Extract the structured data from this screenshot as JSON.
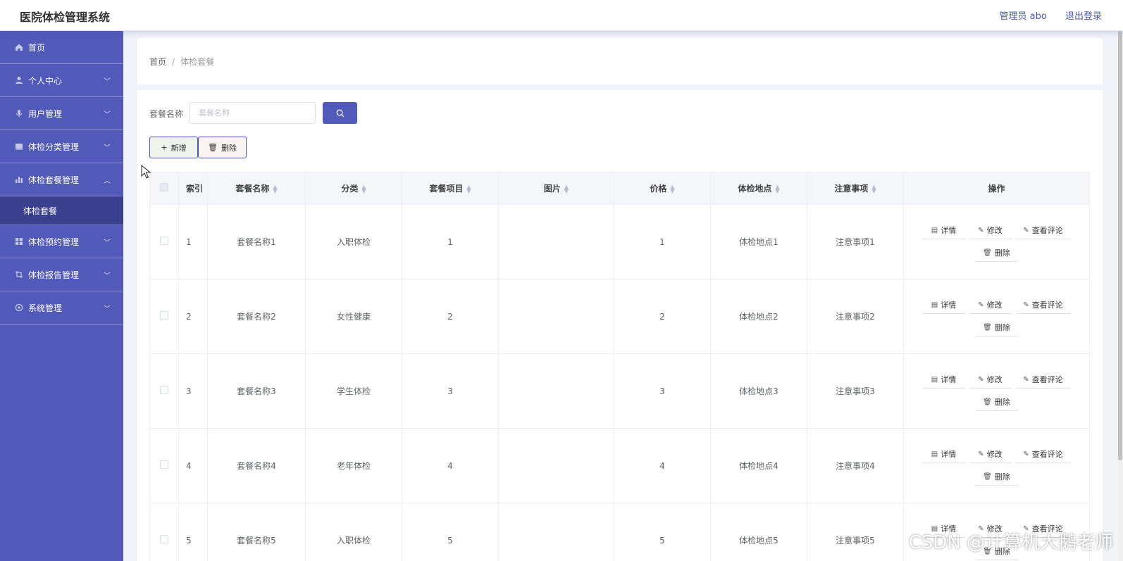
{
  "app": {
    "title": "医院体检管理系统",
    "user_label": "管理员 abo",
    "logout_label": "退出登录"
  },
  "sidebar": {
    "items": [
      {
        "label": "首页",
        "icon": "home-icon",
        "expandable": false
      },
      {
        "label": "个人中心",
        "icon": "user-icon",
        "expandable": true,
        "chevron": "﹀"
      },
      {
        "label": "用户管理",
        "icon": "mic-icon",
        "expandable": true,
        "chevron": "﹀"
      },
      {
        "label": "体检分类管理",
        "icon": "folder-icon",
        "expandable": true,
        "chevron": "﹀"
      },
      {
        "label": "体检套餐管理",
        "icon": "chart-icon",
        "expandable": true,
        "chevron": "︿"
      },
      {
        "label": "体检预约管理",
        "icon": "grid-icon",
        "expandable": true,
        "chevron": "﹀"
      },
      {
        "label": "体检报告管理",
        "icon": "crop-icon",
        "expandable": true,
        "chevron": "﹀"
      },
      {
        "label": "系统管理",
        "icon": "settings-icon",
        "expandable": true,
        "chevron": "﹀"
      }
    ],
    "active_submenu": "体检套餐"
  },
  "breadcrumb": {
    "home": "首页",
    "separator": "/",
    "current": "体检套餐"
  },
  "search": {
    "label": "套餐名称",
    "placeholder": "套餐名称",
    "value": ""
  },
  "toolbar": {
    "add_label": "新增",
    "delete_label": "删除"
  },
  "table": {
    "columns": [
      "索引",
      "套餐名称",
      "分类",
      "套餐项目",
      "图片",
      "价格",
      "体检地点",
      "注意事项",
      "操作"
    ],
    "rows": [
      {
        "index": "1",
        "name": "套餐名称1",
        "category": "入职体检",
        "items": "1",
        "image": "",
        "price": "1",
        "location": "体检地点1",
        "notes": "注意事项1"
      },
      {
        "index": "2",
        "name": "套餐名称2",
        "category": "女性健康",
        "items": "2",
        "image": "",
        "price": "2",
        "location": "体检地点2",
        "notes": "注意事项2"
      },
      {
        "index": "3",
        "name": "套餐名称3",
        "category": "学生体检",
        "items": "3",
        "image": "",
        "price": "3",
        "location": "体检地点3",
        "notes": "注意事项3"
      },
      {
        "index": "4",
        "name": "套餐名称4",
        "category": "老年体检",
        "items": "4",
        "image": "",
        "price": "4",
        "location": "体检地点4",
        "notes": "注意事项4"
      },
      {
        "index": "5",
        "name": "套餐名称5",
        "category": "入职体检",
        "items": "5",
        "image": "",
        "price": "5",
        "location": "体检地点5",
        "notes": "注意事项5"
      }
    ],
    "actions": {
      "detail": "详情",
      "edit": "修改",
      "comments": "查看评论",
      "delete": "删除"
    }
  },
  "watermark": "CSDN @计算机大鹅老师",
  "colors": {
    "sidebar": "#5159b9",
    "sidebar_active": "#3a3f8e",
    "accent": "#4c57a8"
  }
}
